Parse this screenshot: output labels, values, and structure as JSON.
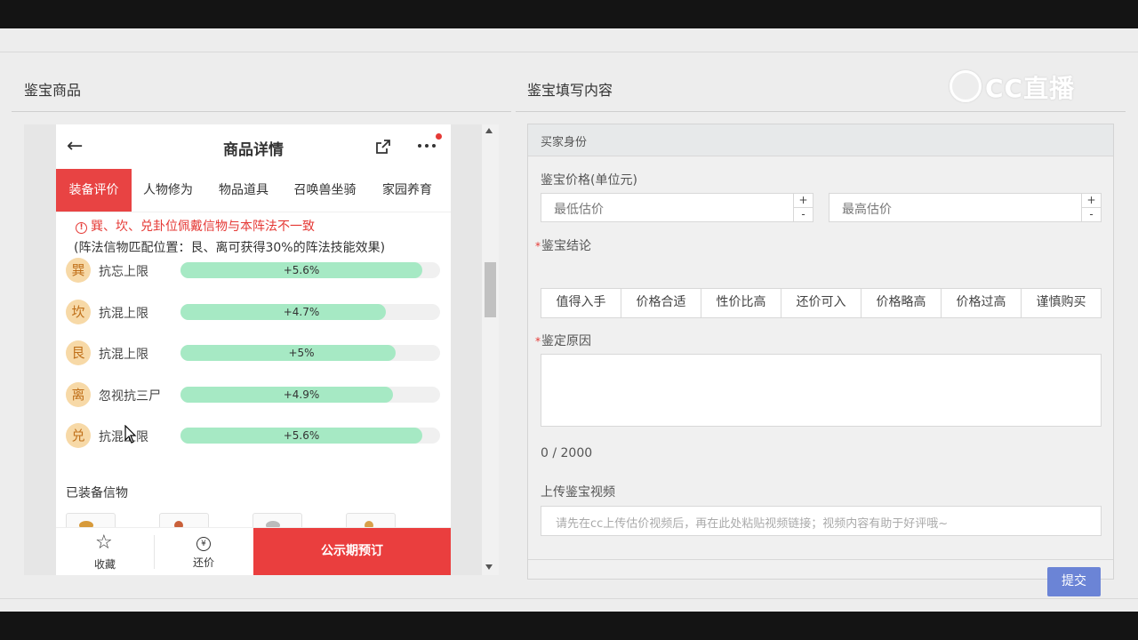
{
  "left_panel": {
    "title": "鉴宝商品"
  },
  "right_panel": {
    "title": "鉴宝填写内容"
  },
  "watermark": "CC直播",
  "phone": {
    "nav": {
      "title": "商品详情"
    },
    "tabs": [
      "装备评价",
      "人物修为",
      "物品道具",
      "召唤兽坐骑",
      "家园养育"
    ],
    "warning": "巽、坎、兑卦位佩戴信物与本阵法不一致",
    "note": "(阵法信物匹配位置：艮、离可获得30%的阵法技能效果)",
    "rows": [
      {
        "badge": "巽",
        "label": "抗忘上限",
        "value": "+5.6%",
        "fill": 0.93
      },
      {
        "badge": "坎",
        "label": "抗混上限",
        "value": "+4.7%",
        "fill": 0.79
      },
      {
        "badge": "艮",
        "label": "抗混上限",
        "value": "+5%",
        "fill": 0.83
      },
      {
        "badge": "离",
        "label": "忽视抗三尸",
        "value": "+4.9%",
        "fill": 0.82
      },
      {
        "badge": "兑",
        "label": "抗混上限",
        "value": "+5.6%",
        "fill": 0.93
      }
    ],
    "equipped_title": "已装备信物",
    "bottom": {
      "collect": "收藏",
      "bargain": "还价",
      "reserve": "公示期预订"
    }
  },
  "form": {
    "section": "买家身份",
    "price_label": "鉴宝价格(单位元)",
    "min_placeholder": "最低估价",
    "max_placeholder": "最高估价",
    "conclusion_label": "鉴宝结论",
    "conclusions": [
      "值得入手",
      "价格合适",
      "性价比高",
      "还价可入",
      "价格略高",
      "价格过高",
      "谨慎购买"
    ],
    "reason_label": "鉴定原因",
    "counter": "0 / 2000",
    "video_label": "上传鉴宝视频",
    "video_placeholder": "请先在cc上传估价视频后，再在此处粘贴视频链接；视频内容有助于好评哦~",
    "submit": "提交"
  },
  "colors": {
    "accent_red": "#e84343",
    "progress_green": "#a6e9c4",
    "submit_blue": "#6b84d6"
  }
}
